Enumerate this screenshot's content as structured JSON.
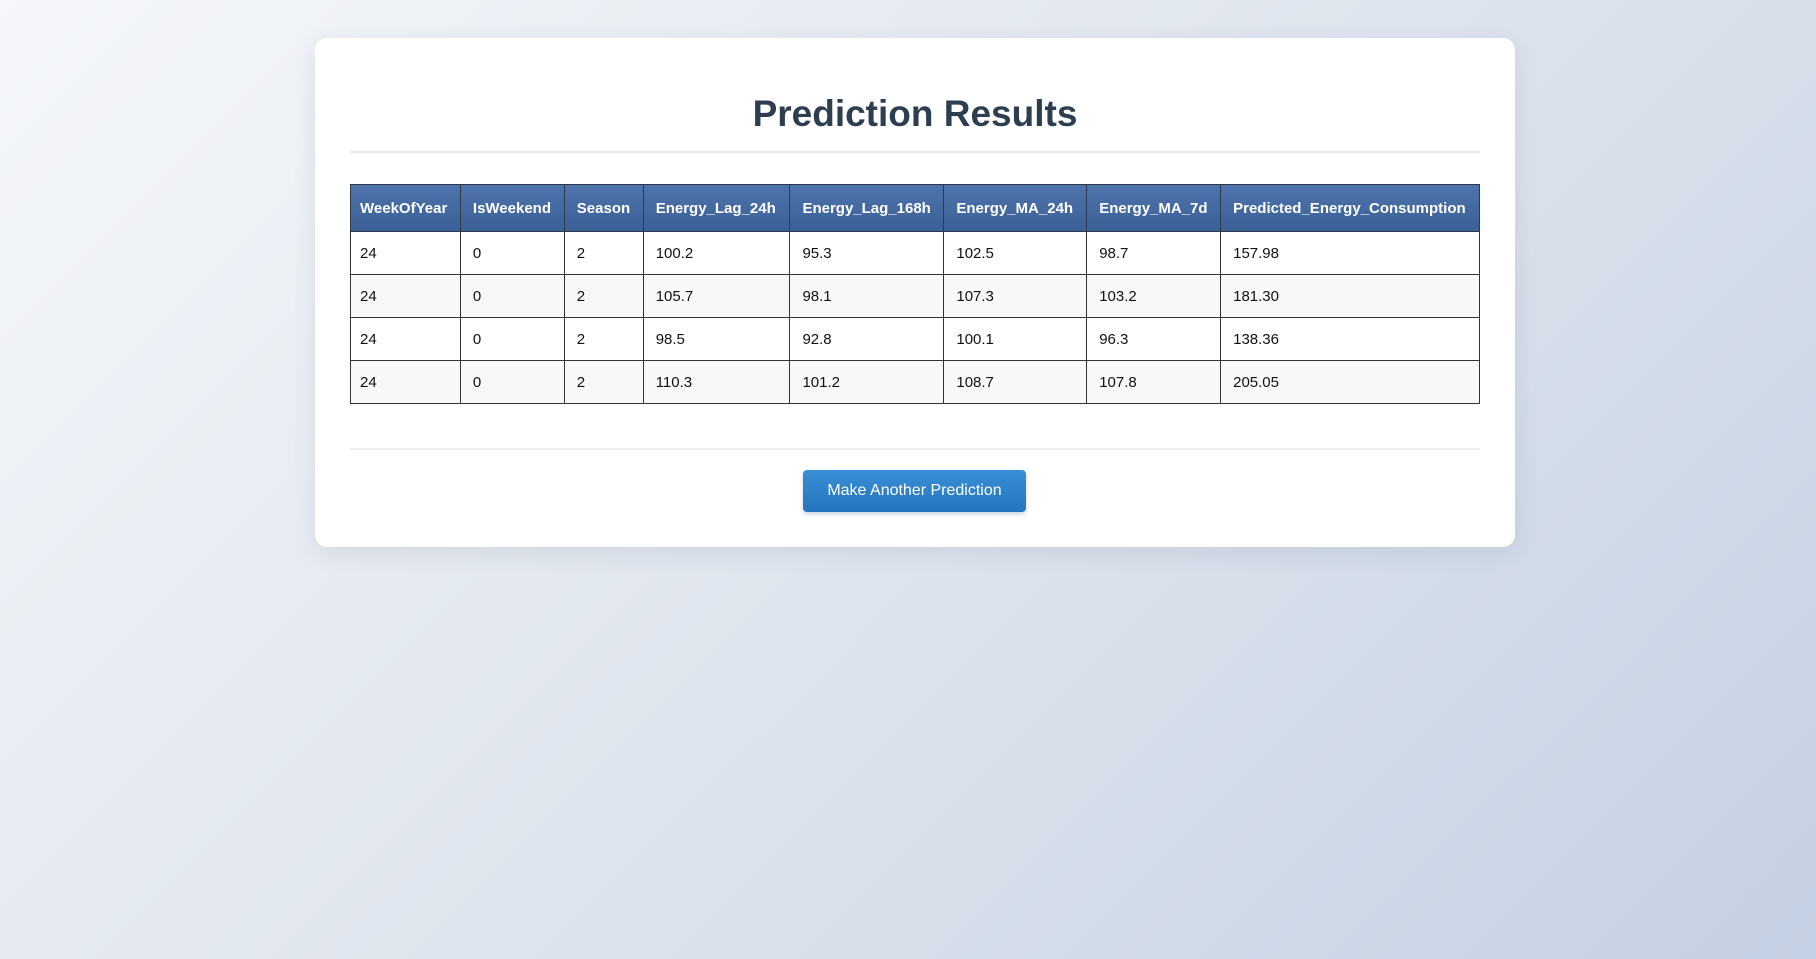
{
  "page": {
    "title": "Prediction Results"
  },
  "table": {
    "headers": [
      "WeekOfYear",
      "IsWeekend",
      "Season",
      "Energy_Lag_24h",
      "Energy_Lag_168h",
      "Energy_MA_24h",
      "Energy_MA_7d",
      "Predicted_Energy_Consumption"
    ],
    "rows": [
      [
        "24",
        "0",
        "2",
        "100.2",
        "95.3",
        "102.5",
        "98.7",
        "157.98"
      ],
      [
        "24",
        "0",
        "2",
        "105.7",
        "98.1",
        "107.3",
        "103.2",
        "181.30"
      ],
      [
        "24",
        "0",
        "2",
        "98.5",
        "92.8",
        "100.1",
        "96.3",
        "138.36"
      ],
      [
        "24",
        "0",
        "2",
        "110.3",
        "101.2",
        "108.7",
        "107.8",
        "205.05"
      ]
    ]
  },
  "actions": {
    "again_label": "Make Another Prediction"
  },
  "colors": {
    "header_bg": "#3f6aa6",
    "button_bg": "#2a7dc7",
    "title": "#2c3e50"
  }
}
